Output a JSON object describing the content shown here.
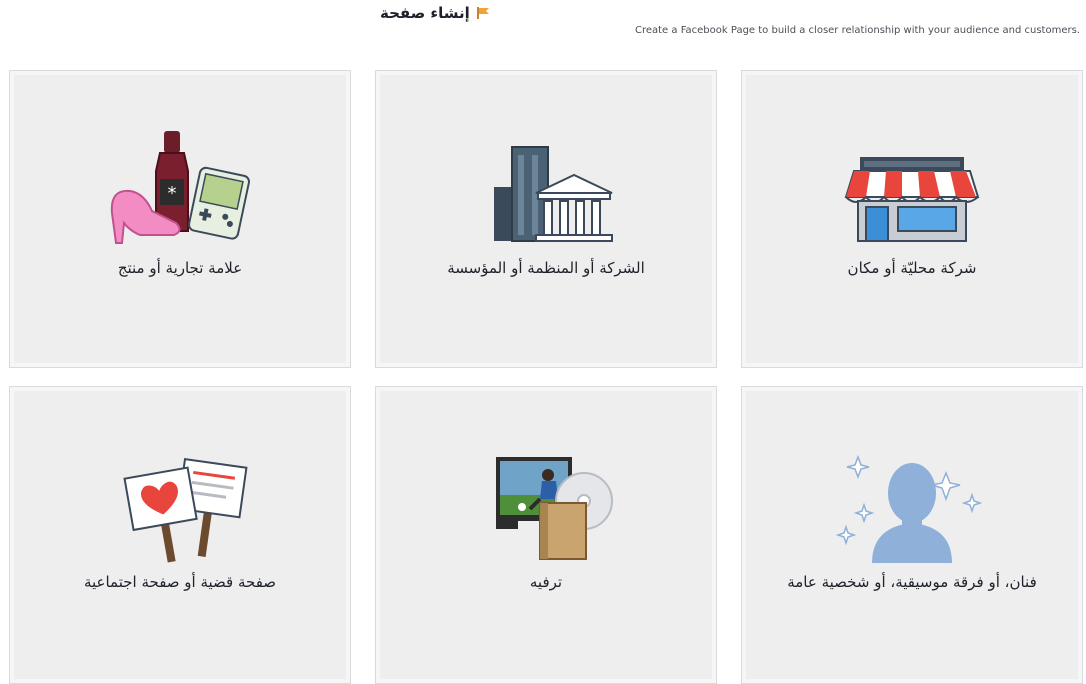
{
  "header": {
    "title": "إنشاء صفحة",
    "subtitle": "Create a Facebook Page to build a closer relationship with your audience and customers."
  },
  "cards": [
    {
      "label": "شركة محليّة أو مكان",
      "icon": "storefront-icon"
    },
    {
      "label": "الشركة أو المنظمة أو المؤسسة",
      "icon": "buildings-icon"
    },
    {
      "label": "علامة تجارية أو منتج",
      "icon": "brand-products-icon"
    },
    {
      "label": "فنان، أو فرقة موسيقية، أو شخصية عامة",
      "icon": "public-figure-icon"
    },
    {
      "label": "ترفيه",
      "icon": "entertainment-icon"
    },
    {
      "label": "صفحة قضية أو صفحة اجتماعية",
      "icon": "cause-signs-icon"
    }
  ],
  "colors": {
    "card_bg": "#eeeeef",
    "awning_red": "#e8453c",
    "shop_blue": "#3b8fd6",
    "building_gray": "#3b4a5a"
  }
}
